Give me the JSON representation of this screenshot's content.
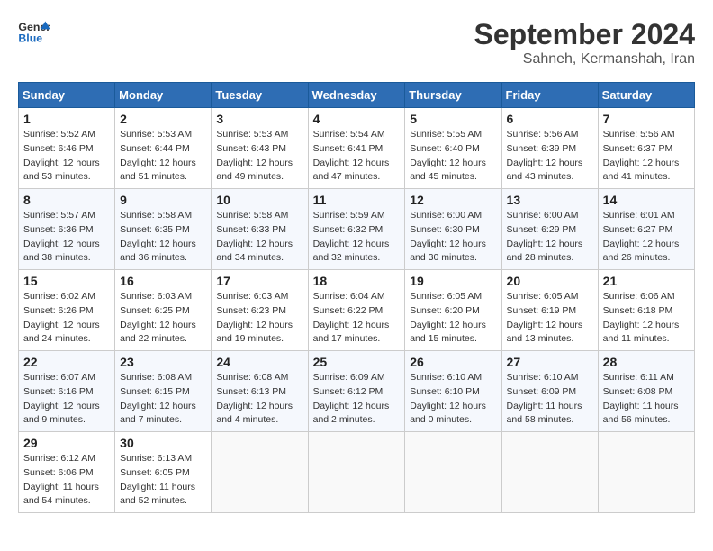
{
  "header": {
    "logo_line1": "General",
    "logo_line2": "Blue",
    "month_year": "September 2024",
    "location": "Sahneh, Kermanshah, Iran"
  },
  "weekdays": [
    "Sunday",
    "Monday",
    "Tuesday",
    "Wednesday",
    "Thursday",
    "Friday",
    "Saturday"
  ],
  "weeks": [
    [
      {
        "day": "1",
        "info": "Sunrise: 5:52 AM\nSunset: 6:46 PM\nDaylight: 12 hours\nand 53 minutes."
      },
      {
        "day": "2",
        "info": "Sunrise: 5:53 AM\nSunset: 6:44 PM\nDaylight: 12 hours\nand 51 minutes."
      },
      {
        "day": "3",
        "info": "Sunrise: 5:53 AM\nSunset: 6:43 PM\nDaylight: 12 hours\nand 49 minutes."
      },
      {
        "day": "4",
        "info": "Sunrise: 5:54 AM\nSunset: 6:41 PM\nDaylight: 12 hours\nand 47 minutes."
      },
      {
        "day": "5",
        "info": "Sunrise: 5:55 AM\nSunset: 6:40 PM\nDaylight: 12 hours\nand 45 minutes."
      },
      {
        "day": "6",
        "info": "Sunrise: 5:56 AM\nSunset: 6:39 PM\nDaylight: 12 hours\nand 43 minutes."
      },
      {
        "day": "7",
        "info": "Sunrise: 5:56 AM\nSunset: 6:37 PM\nDaylight: 12 hours\nand 41 minutes."
      }
    ],
    [
      {
        "day": "8",
        "info": "Sunrise: 5:57 AM\nSunset: 6:36 PM\nDaylight: 12 hours\nand 38 minutes."
      },
      {
        "day": "9",
        "info": "Sunrise: 5:58 AM\nSunset: 6:35 PM\nDaylight: 12 hours\nand 36 minutes."
      },
      {
        "day": "10",
        "info": "Sunrise: 5:58 AM\nSunset: 6:33 PM\nDaylight: 12 hours\nand 34 minutes."
      },
      {
        "day": "11",
        "info": "Sunrise: 5:59 AM\nSunset: 6:32 PM\nDaylight: 12 hours\nand 32 minutes."
      },
      {
        "day": "12",
        "info": "Sunrise: 6:00 AM\nSunset: 6:30 PM\nDaylight: 12 hours\nand 30 minutes."
      },
      {
        "day": "13",
        "info": "Sunrise: 6:00 AM\nSunset: 6:29 PM\nDaylight: 12 hours\nand 28 minutes."
      },
      {
        "day": "14",
        "info": "Sunrise: 6:01 AM\nSunset: 6:27 PM\nDaylight: 12 hours\nand 26 minutes."
      }
    ],
    [
      {
        "day": "15",
        "info": "Sunrise: 6:02 AM\nSunset: 6:26 PM\nDaylight: 12 hours\nand 24 minutes."
      },
      {
        "day": "16",
        "info": "Sunrise: 6:03 AM\nSunset: 6:25 PM\nDaylight: 12 hours\nand 22 minutes."
      },
      {
        "day": "17",
        "info": "Sunrise: 6:03 AM\nSunset: 6:23 PM\nDaylight: 12 hours\nand 19 minutes."
      },
      {
        "day": "18",
        "info": "Sunrise: 6:04 AM\nSunset: 6:22 PM\nDaylight: 12 hours\nand 17 minutes."
      },
      {
        "day": "19",
        "info": "Sunrise: 6:05 AM\nSunset: 6:20 PM\nDaylight: 12 hours\nand 15 minutes."
      },
      {
        "day": "20",
        "info": "Sunrise: 6:05 AM\nSunset: 6:19 PM\nDaylight: 12 hours\nand 13 minutes."
      },
      {
        "day": "21",
        "info": "Sunrise: 6:06 AM\nSunset: 6:18 PM\nDaylight: 12 hours\nand 11 minutes."
      }
    ],
    [
      {
        "day": "22",
        "info": "Sunrise: 6:07 AM\nSunset: 6:16 PM\nDaylight: 12 hours\nand 9 minutes."
      },
      {
        "day": "23",
        "info": "Sunrise: 6:08 AM\nSunset: 6:15 PM\nDaylight: 12 hours\nand 7 minutes."
      },
      {
        "day": "24",
        "info": "Sunrise: 6:08 AM\nSunset: 6:13 PM\nDaylight: 12 hours\nand 4 minutes."
      },
      {
        "day": "25",
        "info": "Sunrise: 6:09 AM\nSunset: 6:12 PM\nDaylight: 12 hours\nand 2 minutes."
      },
      {
        "day": "26",
        "info": "Sunrise: 6:10 AM\nSunset: 6:10 PM\nDaylight: 12 hours\nand 0 minutes."
      },
      {
        "day": "27",
        "info": "Sunrise: 6:10 AM\nSunset: 6:09 PM\nDaylight: 11 hours\nand 58 minutes."
      },
      {
        "day": "28",
        "info": "Sunrise: 6:11 AM\nSunset: 6:08 PM\nDaylight: 11 hours\nand 56 minutes."
      }
    ],
    [
      {
        "day": "29",
        "info": "Sunrise: 6:12 AM\nSunset: 6:06 PM\nDaylight: 11 hours\nand 54 minutes."
      },
      {
        "day": "30",
        "info": "Sunrise: 6:13 AM\nSunset: 6:05 PM\nDaylight: 11 hours\nand 52 minutes."
      },
      {
        "day": "",
        "info": ""
      },
      {
        "day": "",
        "info": ""
      },
      {
        "day": "",
        "info": ""
      },
      {
        "day": "",
        "info": ""
      },
      {
        "day": "",
        "info": ""
      }
    ]
  ]
}
